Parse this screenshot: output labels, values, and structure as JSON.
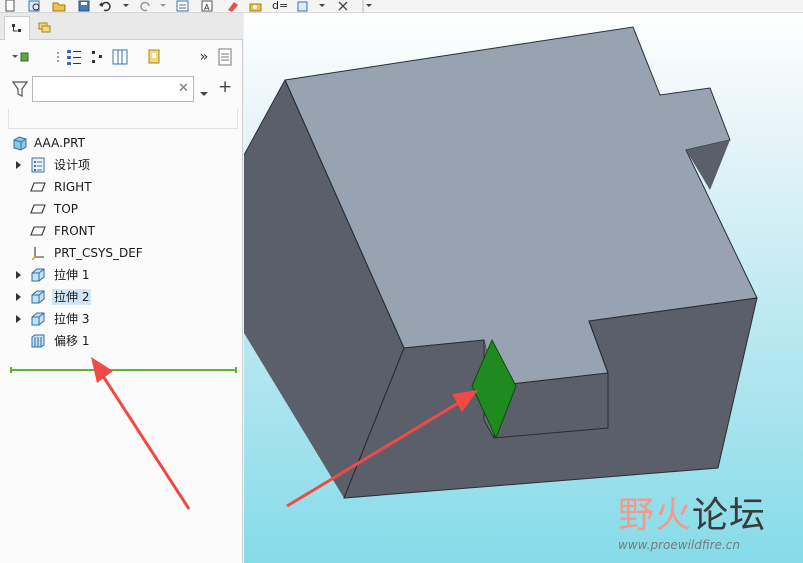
{
  "toolbar": {
    "icons": [
      "new-icon",
      "regenerate-icon",
      "open-icon",
      "save-icon",
      "undo-icon",
      "dropdown-icon",
      "redo-icon",
      "dropdown-icon",
      "windows-icon",
      "annotation-icon",
      "erase-icon",
      "save-view-icon",
      "d-equals-icon",
      "display-style-icon",
      "dropdown-icon",
      "close-window-icon",
      "customize-icon"
    ],
    "d_label": "d="
  },
  "panel": {
    "tabs": [
      "model-tree-tab",
      "layer-tree-tab"
    ],
    "more_label": "»",
    "search": {
      "value": "",
      "placeholder": ""
    },
    "add_label": "+"
  },
  "tree": {
    "root": "AAA.PRT",
    "items": [
      {
        "label": "设计项",
        "icon": "design-items-icon",
        "expandable": true
      },
      {
        "label": "RIGHT",
        "icon": "datum-plane-icon",
        "expandable": false
      },
      {
        "label": "TOP",
        "icon": "datum-plane-icon",
        "expandable": false
      },
      {
        "label": "FRONT",
        "icon": "datum-plane-icon",
        "expandable": false
      },
      {
        "label": "PRT_CSYS_DEF",
        "icon": "csys-icon",
        "expandable": false
      },
      {
        "label": "拉伸 1",
        "icon": "extrude-icon",
        "expandable": true
      },
      {
        "label": "拉伸 2",
        "icon": "extrude-icon",
        "expandable": true,
        "selected": true
      },
      {
        "label": "拉伸 3",
        "icon": "extrude-icon",
        "expandable": true
      },
      {
        "label": "偏移 1",
        "icon": "offset-icon",
        "expandable": false
      }
    ]
  },
  "watermark": {
    "title_colored": "野火",
    "title_dark": "论坛",
    "url": "www.proewildfire.cn"
  },
  "colors": {
    "model_top": "#97a3b1",
    "model_side": "#5a5f69",
    "highlight": "#1f8a1f",
    "arrow": "#f04a44",
    "insert_bar": "#5cb335",
    "selection": "#cfe6f7"
  }
}
